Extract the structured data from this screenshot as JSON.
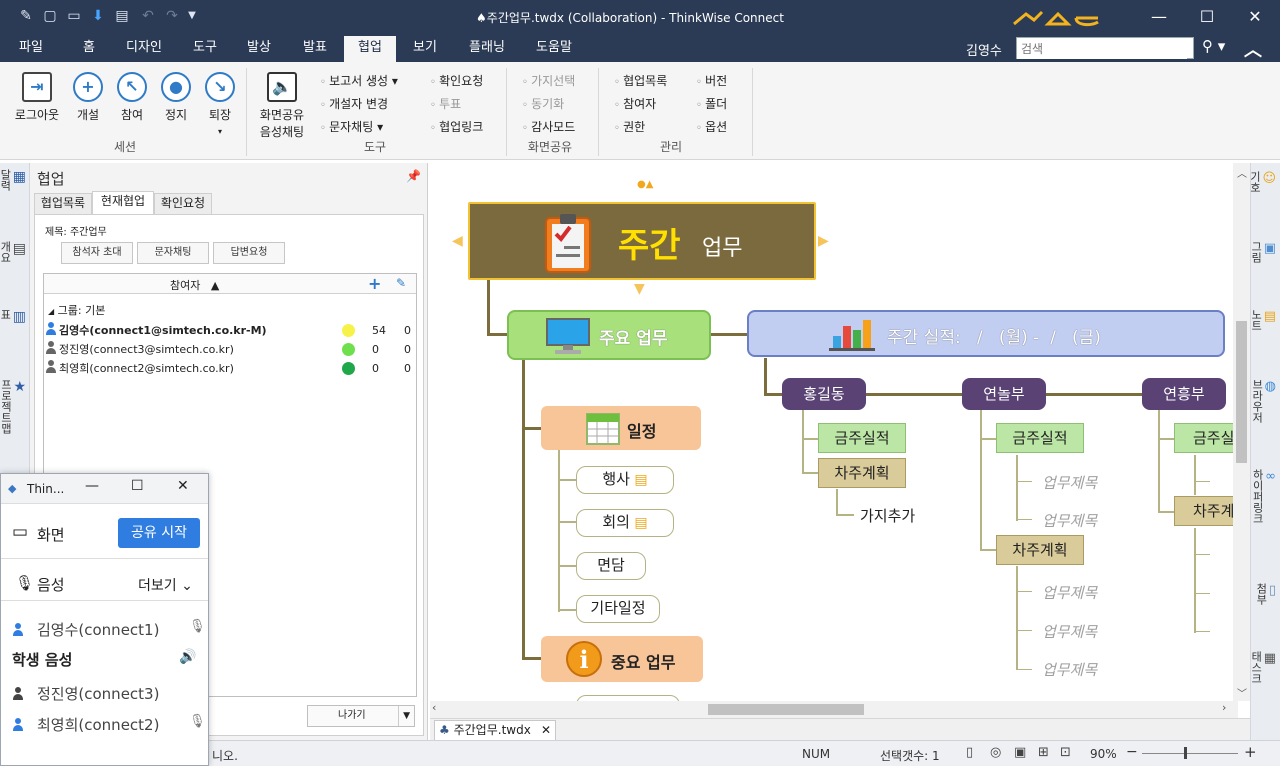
{
  "window": {
    "title": "♠주간업무.twdx (Collaboration) - ThinkWise Connect",
    "minimize": "—",
    "maximize": "☐",
    "close": "✕"
  },
  "quick_access": [
    "pen-icon",
    "new-icon",
    "open-icon",
    "save-icon",
    "presentation-icon",
    "undo-icon",
    "redo-icon",
    "dropdown-icon"
  ],
  "menu": {
    "tabs": [
      "파일",
      "홈",
      "디자인",
      "도구",
      "발상",
      "발표",
      "협업",
      "보기",
      "플래닝",
      "도움말"
    ],
    "active_tab": "협업",
    "user": "김영수",
    "search_placeholder": "검색"
  },
  "ribbon": {
    "session": {
      "label": "세션",
      "buttons": [
        "로그아웃",
        "개설",
        "참여",
        "정지",
        "퇴장"
      ]
    },
    "tools": {
      "label": "도구",
      "big_button_line1": "화면공유",
      "big_button_line2": "음성채팅",
      "col1": [
        "보고서 생성",
        "개설자 변경",
        "문자채팅"
      ],
      "col2": [
        "확인요청",
        "투표",
        "협업링크"
      ]
    },
    "screen_share": {
      "label": "화면공유",
      "items": [
        "가지선택",
        "동기화",
        "감사모드"
      ]
    },
    "manage": {
      "label": "관리",
      "col1": [
        "협업목록",
        "참여자",
        "권한"
      ],
      "col2": [
        "버전",
        "폴더",
        "옵션"
      ]
    }
  },
  "left_strip": [
    "달력",
    "개요",
    "표",
    "프로젝트맵"
  ],
  "right_strip": [
    "기호",
    "그림",
    "노트",
    "브라우저",
    "하이퍼링크",
    "첨부",
    "태스크"
  ],
  "panel": {
    "title": "협업",
    "pin_icon": "pin-icon",
    "tabs": [
      "협업목록",
      "현재협업",
      "확인요청"
    ],
    "active_tab": "현재협업",
    "subject_label": "제목: 주간업무",
    "buttons": [
      "참석자 초대",
      "문자채팅",
      "답변요청"
    ],
    "table_header": "참여자",
    "group_label": "그룹: 기본",
    "participants": [
      {
        "name": "김영수(connect1@simtech.co.kr-M)",
        "color": "#f7f24a",
        "a": "54",
        "b": "0",
        "bold": true
      },
      {
        "name": "정진영(connect3@simtech.co.kr)",
        "color": "#6fe04d",
        "a": "0",
        "b": "0",
        "bold": false
      },
      {
        "name": "최영희(connect2@simtech.co.kr)",
        "color": "#1fa84a",
        "a": "0",
        "b": "0",
        "bold": false
      }
    ],
    "leave_button": "나가기"
  },
  "floating": {
    "title": "Thin...",
    "screen_label": "화면",
    "share_button": "공유 시작",
    "voice_label": "음성",
    "more_label": "더보기",
    "members": [
      "김영수(connect1)"
    ],
    "student_voice": "학생 음성",
    "students": [
      "정진영(connect3)",
      "최영희(connect2)"
    ]
  },
  "mindmap": {
    "root_bold": "주간",
    "root_rest": "업무",
    "main_work": "주요 업무",
    "weekly_perf": "주간 실적:   /   (월) -  /   (금)",
    "schedule": "일정",
    "schedule_items": [
      "행사",
      "회의",
      "면담",
      "기타일정"
    ],
    "important": "중요 업무",
    "people": [
      "홍길동",
      "연놀부",
      "연흥부"
    ],
    "this_week": "금주실적",
    "next_week": "차주계획",
    "add_branch": "가지추가",
    "placeholder": "업무제목"
  },
  "doc_tab": "주간업무.twdx",
  "status": {
    "left": "니오.",
    "num": "NUM",
    "selected": "선택갯수: 1",
    "zoom": "90%"
  },
  "colors": {
    "title_bg": "#2b3a55",
    "root_bg": "#7a6a3d",
    "root_text": "#ffe000",
    "main_green": "#a8e07c",
    "perf_blue": "#c2cdf2",
    "person_purple": "#5a4275",
    "orange_node": "#f8c598",
    "green_sub": "#bce6a5",
    "khaki_sub": "#d9cc9a"
  }
}
